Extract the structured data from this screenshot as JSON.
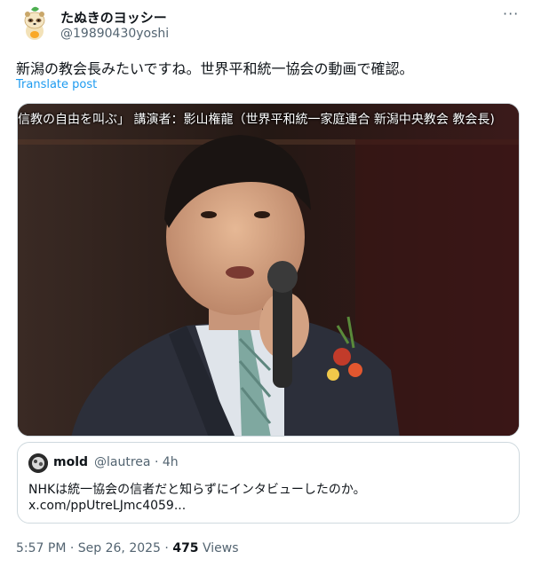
{
  "post": {
    "display_name": "たぬきのヨッシー",
    "handle": "@19890430yoshi",
    "more_label": "···",
    "text": "新潟の教会長みたいですね。世界平和統一協会の動画で確認。",
    "translate_label": "Translate post"
  },
  "media": {
    "caption": "信教の自由を叫ぶ」 講演者：影山権龍（世界平和統一家庭連合 新潟中央教会 教会長)"
  },
  "quote": {
    "display_name": "mold",
    "handle": "@lautrea",
    "separator": "·",
    "time": "4h",
    "text": "NHKは統一協会の信者だと知らずにインタビューしたのか。",
    "link": "x.com/ppUtreLJmc4059..."
  },
  "footer": {
    "time": "5:57 PM",
    "separator": "·",
    "date": "Sep 26, 2025",
    "separator2": "·",
    "views_count": "475",
    "views_label": "Views"
  },
  "colors": {
    "link": "#1d9bf0",
    "secondary_text": "#536471",
    "border": "#cfd9de"
  }
}
